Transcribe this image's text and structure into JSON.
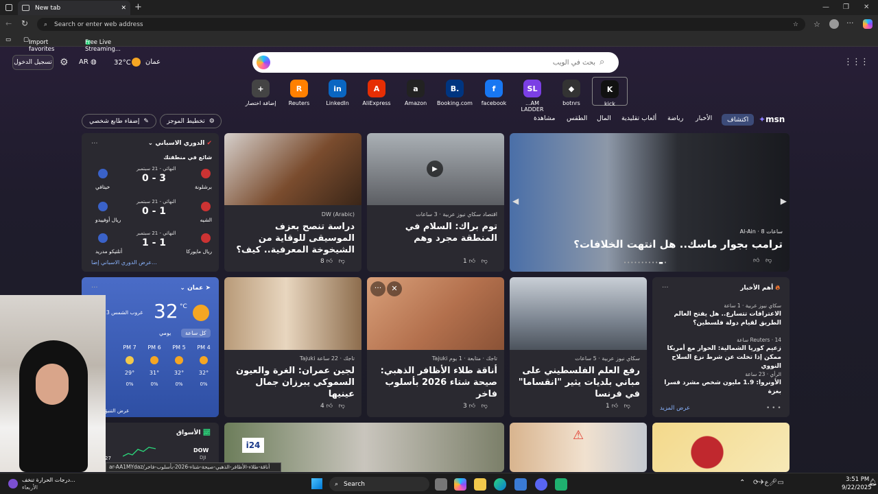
{
  "browser": {
    "tab_title": "New tab",
    "address_placeholder": "Search or enter web address",
    "favorites": [
      "Import favorites",
      "Free Live Streaming..."
    ]
  },
  "header": {
    "login": "تسجيل الدخول",
    "language": "AR",
    "temperature": "32°C",
    "city": "عمان",
    "search_placeholder": "بحث في الويب"
  },
  "quick_links": [
    {
      "label": "إضافة اختصار",
      "icon": "+",
      "color": "#444"
    },
    {
      "label": "Reuters",
      "icon": "R",
      "color": "#ff8000"
    },
    {
      "label": "LinkedIn",
      "icon": "in",
      "color": "#0a66c2"
    },
    {
      "label": "AliExpress",
      "icon": "A",
      "color": "#e62e04"
    },
    {
      "label": "Amazon",
      "icon": "a",
      "color": "#222"
    },
    {
      "label": "Booking.com",
      "icon": "B.",
      "color": "#003580"
    },
    {
      "label": "facebook",
      "icon": "f",
      "color": "#1877f2"
    },
    {
      "label": "...AM LADDER",
      "icon": "SL",
      "color": "#7b3fe4"
    },
    {
      "label": "botnrs",
      "icon": "◆",
      "color": "#333"
    },
    {
      "label": "kick",
      "icon": "K",
      "color": "#111"
    }
  ],
  "nav": {
    "brand": "msn",
    "items": [
      "اكتشاف",
      "الأخبار",
      "رياضة",
      "ألعاب تقليدية",
      "المال",
      "الطقس",
      "مشاهدة"
    ],
    "layout_btn": "تخطيط الموجز",
    "personalize_btn": "إضفاء طابع شخصي"
  },
  "sports": {
    "league": "الدوري الاسباني",
    "trending": "شائع في منطقتك",
    "matches": [
      {
        "home": "برشلونة",
        "away": "خيتافي",
        "score": "0 - 3",
        "status": "النهائي - 21 سبتمبر"
      },
      {
        "home": "الشيه",
        "away": "ريال أوفييدو",
        "score": "0 - 1",
        "status": "النهائي - 21 سبتمبر"
      },
      {
        "home": "ريال مايوركا",
        "away": "أتلتيكو مدريد",
        "score": "1 - 1",
        "status": "النهائي - 21 سبتمبر"
      }
    ],
    "footer": "عرض الدوري الاسباني إضا..."
  },
  "cards_row1": [
    {
      "source": "DW (Arabic)",
      "title": "دراسة تنصح بعزف الموسيقى للوقاية من الشيخوخة المعرفية.. كيف؟",
      "likes": "8"
    },
    {
      "source": "اقتصاد سكاي نيوز عربية · 3 ساعات",
      "title": "توم براك: السلام في المنطقة مجرد وهم",
      "likes": "1"
    },
    {
      "source": "Al-Ain · 8 ساعات",
      "title": "ترامب بجوار ماسك.. هل انتهت الخلافات؟",
      "likes": ""
    }
  ],
  "weather": {
    "city": "عمان",
    "temp": "32",
    "unit": "°C",
    "sunset": "غروب الشمس 3",
    "tab_hourly": "كل ساعة",
    "tab_daily": "يومي",
    "hours": [
      {
        "t": "PM 4",
        "v": "32°",
        "p": "0%"
      },
      {
        "t": "PM 5",
        "v": "32°",
        "p": "0%"
      },
      {
        "t": "PM 6",
        "v": "31°",
        "p": "0%"
      },
      {
        "t": "PM 7",
        "v": "29°",
        "p": "0%"
      }
    ],
    "footer": "عرض التنبؤ ا"
  },
  "cards_row2": [
    {
      "source": "Tajuki تاجك · 22 ساعة",
      "title": "لجين عمران: الغرة والعيون السموكي يبرزان جمال عينيها",
      "likes": "4"
    },
    {
      "source": "Tajuki تاجك · متابعة · 1 يوم",
      "title": "أناقة طلاء الأظافر الذهبي: صيحة شتاء 2026 بأسلوب فاخر",
      "likes": "3"
    },
    {
      "source": "سكاي نيوز عربية · 5 ساعات",
      "title": "رفع العلم الفلسطيني على مباني بلديات يثير \"انقساما\" في فرنسا",
      "likes": "1"
    }
  ],
  "top_news": {
    "header": "أهم الأخبار",
    "items": [
      {
        "source": "سكاي نيوز عربية · 1 ساعة",
        "title": "الاعترافات تتسارع.. هل يفتح العالم الطريق لقيام دولة فلسطين؟"
      },
      {
        "source": "Reuters · 14 ساعة",
        "title": "زعيم كوريا الشمالية: الحوار مع أمريكا ممكن إذا تخلت عن شرط نزع السلاح النووي"
      },
      {
        "source": "الرأي · 23 ساعة",
        "title": "الأونروا: 1.9 مليون شخص مشرد قسرا بغزة"
      }
    ],
    "more": "عرض المزيد"
  },
  "markets": {
    "header": "الأسواق",
    "ticker": "DOW",
    "sub": "DJI",
    "val": "27"
  },
  "status_url": "ar-AA1MYdaz/أناقة-طلاء-الأظافر-الذهبي-صيحة-شتاء-2026-بأسلوب-فاخر",
  "taskbar": {
    "weather_line1": "درجات الحرارة تنخف...",
    "weather_line2": "الأربعاء",
    "search": "Search",
    "time": "3:51 PM",
    "date": "9/22/2025"
  }
}
